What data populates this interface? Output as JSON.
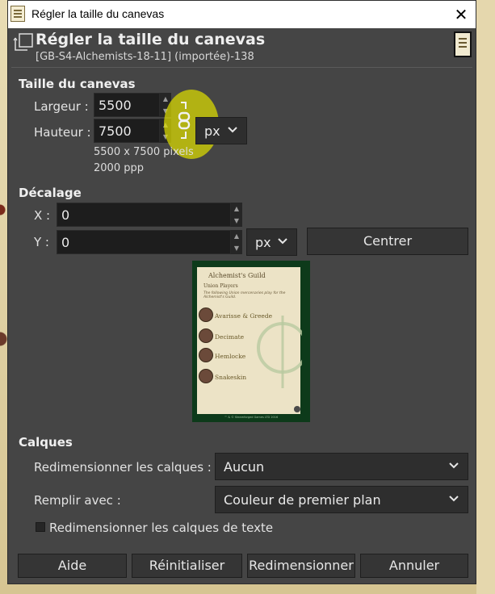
{
  "window": {
    "title": "Régler la taille du canevas"
  },
  "header": {
    "title": "Régler la taille du canevas",
    "subtitle": "[GB-S4-Alchemists-18-11] (importée)-138"
  },
  "canvas_size": {
    "section_label": "Taille du canevas",
    "width_label": "Largeur :",
    "width_value": "5500",
    "height_label": "Hauteur :",
    "height_value": "7500",
    "unit": "px",
    "size_info": "5500 x 7500 pixels",
    "resolution_info": "2000 ppp"
  },
  "offset": {
    "section_label": "Décalage",
    "x_label": "X :",
    "x_value": "0",
    "y_label": "Y :",
    "y_value": "0",
    "unit": "px",
    "center_button": "Centrer"
  },
  "preview": {
    "card_title": "Alchemist's Guild",
    "card_subtitle": "Union Players",
    "card_desc": "The following Union mercenaries play for the Alchemist's Guild.",
    "players": [
      "Avarisse & Greede",
      "Decimate",
      "Hemlocke",
      "Snakeskin"
    ],
    "footer": "™ & © Steamforged Games LTD 2016"
  },
  "layers": {
    "section_label": "Calques",
    "resize_label": "Redimensionner les calques :",
    "resize_value": "Aucun",
    "fill_label": "Remplir avec :",
    "fill_value": "Couleur de premier plan",
    "text_layers_label": "Redimensionner les calques de texte"
  },
  "buttons": {
    "help": "Aide",
    "reset": "Réinitialiser",
    "resize": "Redimensionner",
    "cancel": "Annuler"
  },
  "colors": {
    "dialog_bg": "#454545",
    "field_bg": "#1d1d1d",
    "highlight": "#dcdc00"
  }
}
